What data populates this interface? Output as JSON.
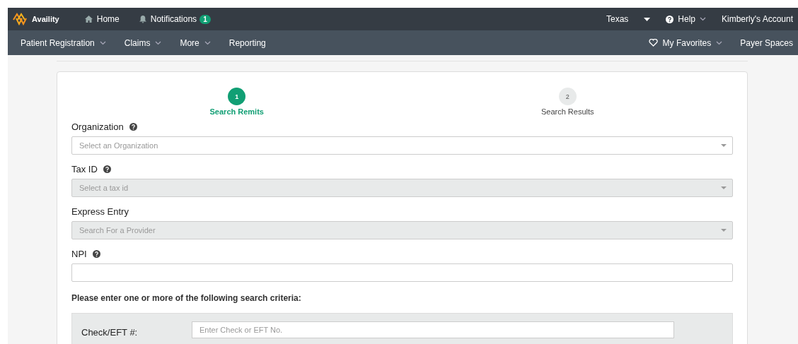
{
  "top_bar": {
    "brand": "Availity",
    "links": [
      {
        "kind": "home",
        "label": "Home"
      },
      {
        "kind": "notifications",
        "label": "Notifications",
        "badge": "1"
      }
    ],
    "right": [
      {
        "kind": "region",
        "label": "Texas"
      },
      {
        "kind": "help",
        "label": "Help"
      },
      {
        "kind": "account",
        "label": "Kimberly's Account"
      }
    ]
  },
  "nav_bar": {
    "left": [
      {
        "label": "Patient Registration",
        "dropdown": true
      },
      {
        "label": "Claims",
        "dropdown": true
      },
      {
        "label": "More",
        "dropdown": true
      },
      {
        "label": "Reporting",
        "dropdown": false
      }
    ],
    "right": [
      {
        "label": "My Favorites",
        "dropdown": true,
        "kind": "favorites"
      },
      {
        "label": "Payer Spaces",
        "dropdown": false,
        "kind": "plain"
      }
    ]
  },
  "steps": [
    {
      "number": "1",
      "label": "Search Remits",
      "selected": true
    },
    {
      "number": "2",
      "label": "Search Results",
      "selected": false
    }
  ],
  "fields": [
    {
      "label": "Organization",
      "help": true,
      "kind": "select",
      "placeholder": "Select an Organization",
      "disabled": false
    },
    {
      "label": "Tax ID",
      "help": true,
      "kind": "select",
      "placeholder": "Select a tax id",
      "disabled": true
    },
    {
      "label": "Express Entry",
      "help": false,
      "kind": "select",
      "placeholder": "Search For a Provider",
      "disabled": true
    },
    {
      "label": "NPI",
      "help": true,
      "kind": "text",
      "disabled": false
    }
  ],
  "criteria": {
    "heading": "Please enter one or more of the following search criteria:",
    "rows": [
      {
        "label": "Check/EFT #:",
        "placeholder": "Enter Check or EFT No."
      }
    ]
  }
}
